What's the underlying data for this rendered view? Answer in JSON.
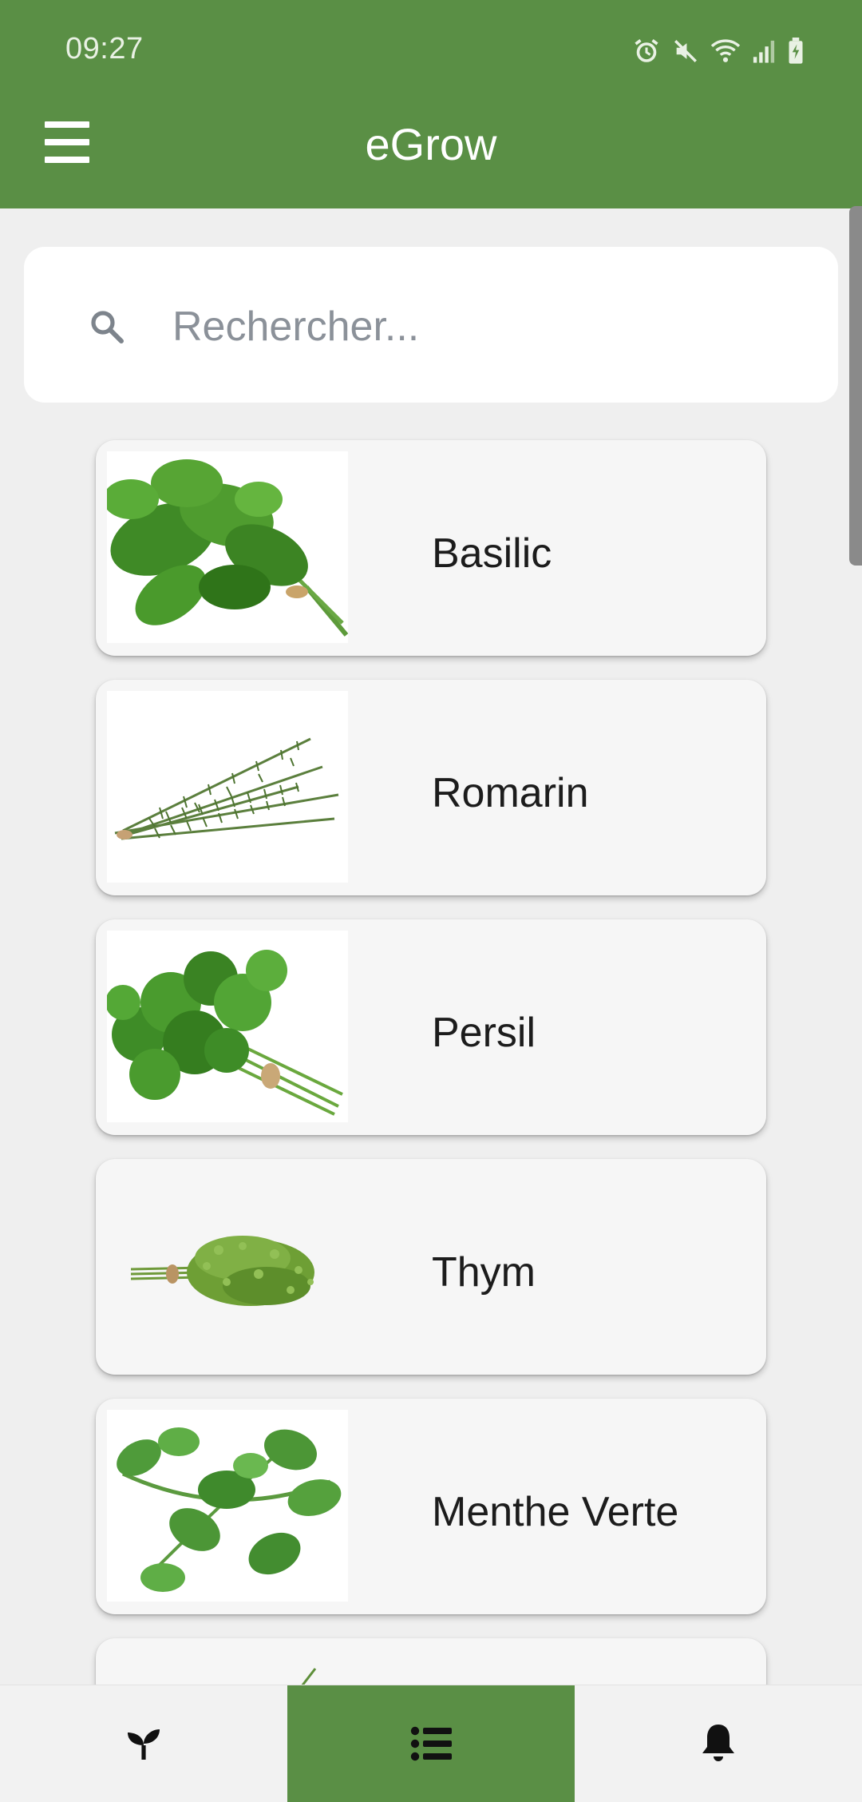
{
  "status_bar": {
    "time": "09:27",
    "icons": [
      "alarm-icon",
      "mute-icon",
      "wifi-icon",
      "signal-icon",
      "battery-charging-icon"
    ]
  },
  "app_bar": {
    "menu_icon": "hamburger-menu-icon",
    "title": "eGrow"
  },
  "search": {
    "icon": "search-icon",
    "placeholder": "Rechercher...",
    "value": ""
  },
  "plants": [
    {
      "name": "Basilic",
      "image": "basil-image"
    },
    {
      "name": "Romarin",
      "image": "rosemary-image"
    },
    {
      "name": "Persil",
      "image": "parsley-image"
    },
    {
      "name": "Thym",
      "image": "thyme-image"
    },
    {
      "name": "Menthe Verte",
      "image": "mint-image"
    }
  ],
  "bottom_nav": {
    "items": [
      {
        "icon": "seedling-icon",
        "active": false
      },
      {
        "icon": "list-icon",
        "active": true
      },
      {
        "icon": "bell-icon",
        "active": false
      }
    ]
  },
  "colors": {
    "primary": "#5a8f45",
    "background": "#efefef",
    "card": "#f6f6f6"
  }
}
